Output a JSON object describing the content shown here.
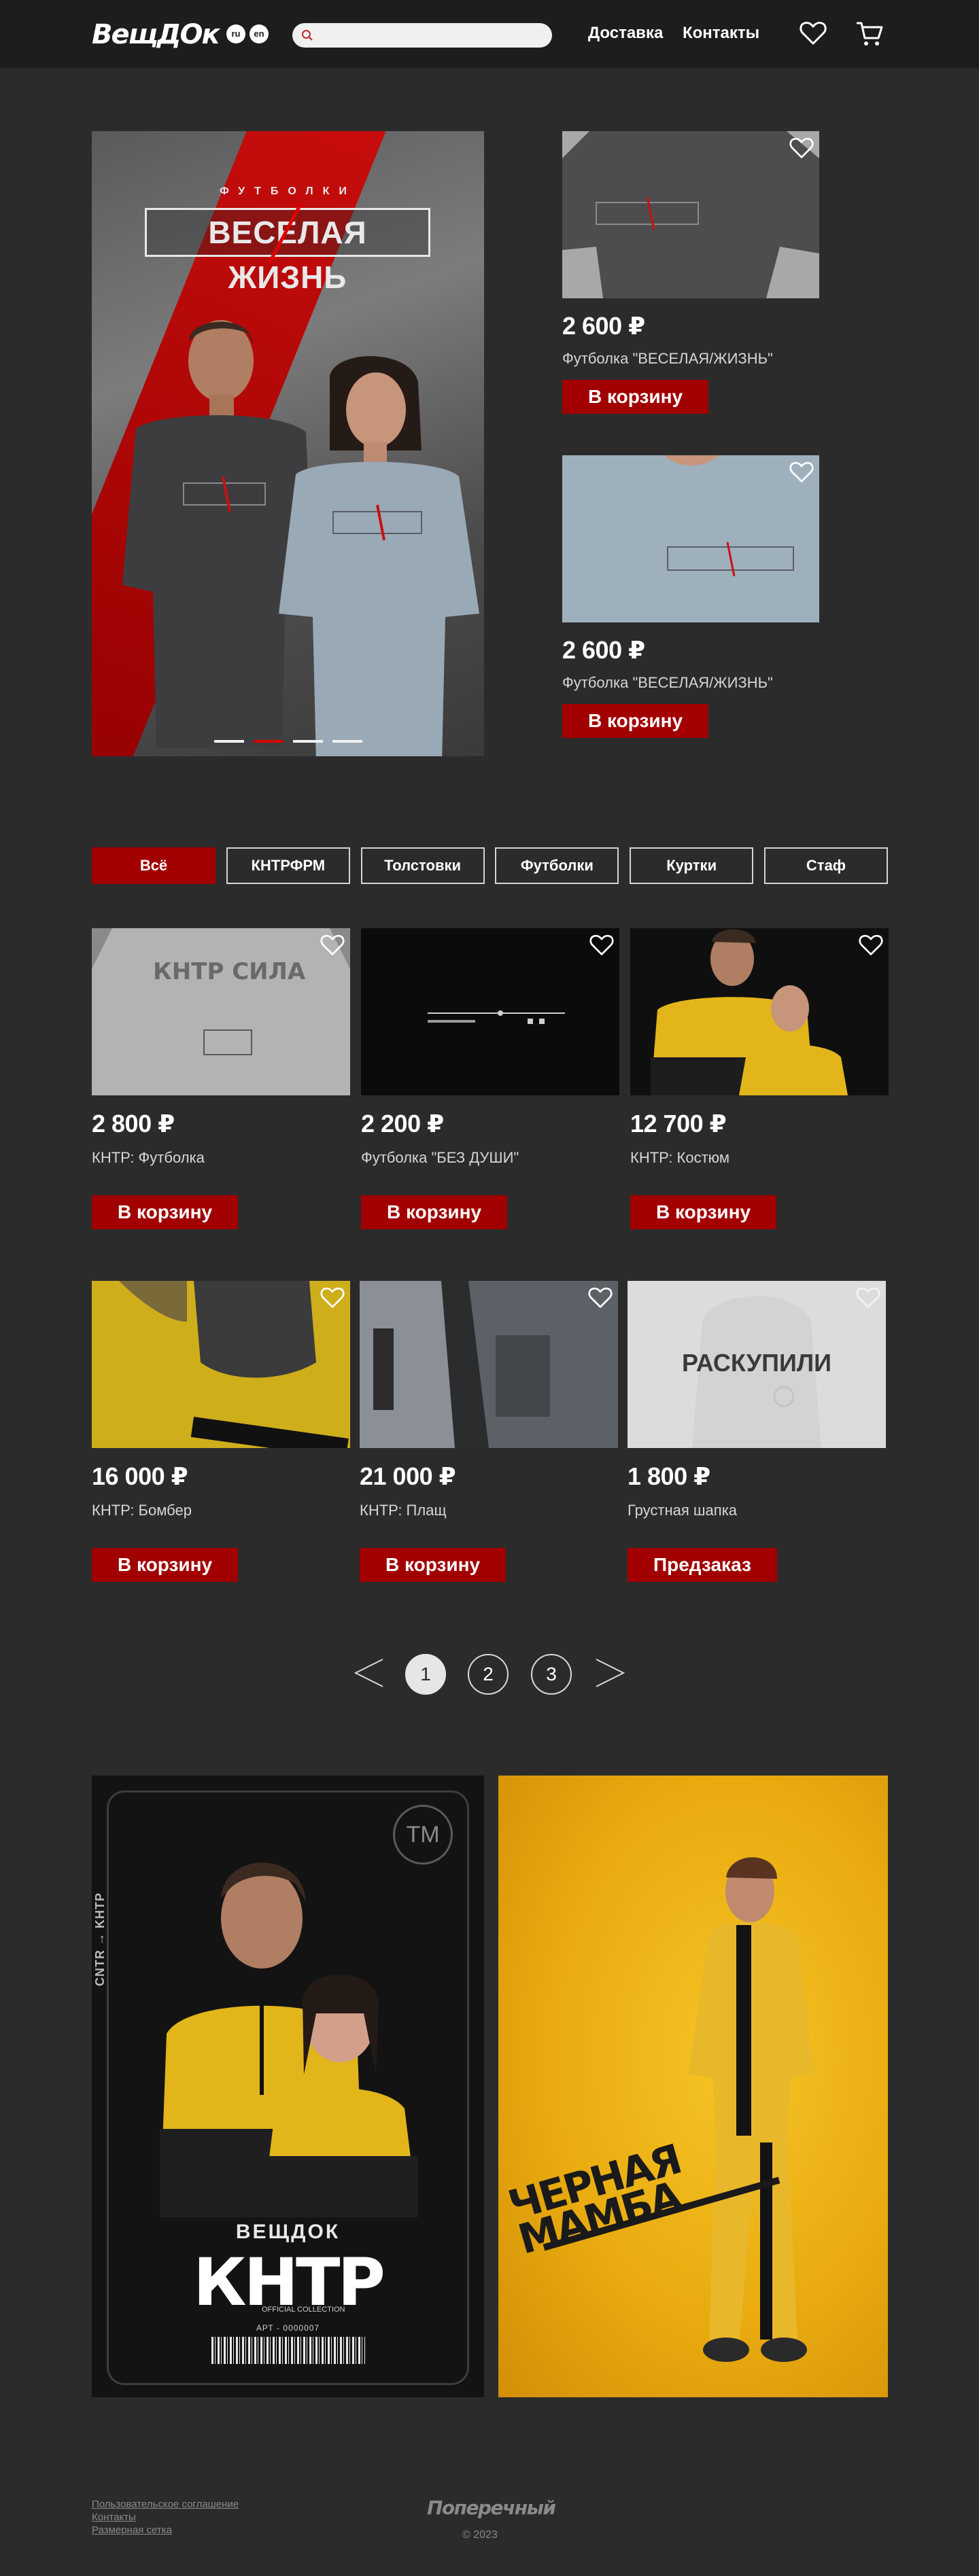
{
  "header": {
    "logo": "ВещДОк",
    "lang_ru": "ru",
    "lang_en": "en",
    "search_placeholder": "",
    "nav": [
      "Доставка",
      "Контакты"
    ]
  },
  "hero": {
    "kicker": "ФУТБОЛКИ",
    "title": "ВЕСЕЛАЯ ЖИЗНЬ",
    "slides": 4,
    "active_slide": 1
  },
  "featured": [
    {
      "price": "2 600 ₽",
      "name": "Футболка \"ВЕСЕЛАЯ/ЖИЗНЬ\"",
      "button": "В корзину",
      "print": "ВЕСЕЛАЯ/ЖИЗНЬ",
      "bg": "#a8a8a8",
      "shirt": "#4a4a4a"
    },
    {
      "price": "2 600 ₽",
      "name": "Футболка \"ВЕСЕЛАЯ/ЖИЗНЬ\"",
      "button": "В корзину",
      "print": "ВЕСЕЛАЯ/ЖИЗНЬ",
      "bg": "#8fa0ad",
      "shirt": "#9aabb8"
    }
  ],
  "filters": [
    {
      "label": "Всё",
      "active": true
    },
    {
      "label": "КНТРФРМ",
      "active": false
    },
    {
      "label": "Толстовки",
      "active": false
    },
    {
      "label": "Футболки",
      "active": false
    },
    {
      "label": "Куртки",
      "active": false
    },
    {
      "label": "Стаф",
      "active": false
    }
  ],
  "products": [
    {
      "price": "2 800 ₽",
      "name": "КНТР: Футболка",
      "button": "В корзину",
      "overlay": "КНТР СИЛА",
      "color": "#8e8e8e"
    },
    {
      "price": "2 200 ₽",
      "name": "Футболка \"БЕЗ ДУШИ\"",
      "button": "В корзину",
      "overlay": "",
      "color": "#0c0c0c"
    },
    {
      "price": "12 700 ₽",
      "name": "КНТР: Костюм",
      "button": "В корзину",
      "overlay": "",
      "color": "#111111"
    },
    {
      "price": "16 000 ₽",
      "name": "КНТР: Бомбер",
      "button": "В корзину",
      "overlay": "",
      "color": "#c7a61a"
    },
    {
      "price": "21 000 ₽",
      "name": "КНТР: Плащ",
      "button": "В корзину",
      "overlay": "",
      "color": "#6e7378"
    },
    {
      "price": "1 800 ₽",
      "name": "Грустная шапка",
      "button": "Предзаказ",
      "overlay": "РАСКУПИЛИ",
      "color": "#d8d8d8"
    }
  ],
  "pagination": {
    "pages": [
      "1",
      "2",
      "3"
    ],
    "current": "1"
  },
  "promo": {
    "vertical_text": "CNTR → KHTP",
    "brand": "ВЕЩДОК",
    "logo": "КНТР",
    "tm": "TM",
    "badge": "OFFICIAL COLLECTION",
    "article": "АРТ - 0000007",
    "mamba_line1": "ЧЕРНАЯ",
    "mamba_line2": "МАМБА"
  },
  "footer": {
    "links": [
      "Пользовательское соглашение",
      "Контакты",
      "Размерная сетка"
    ],
    "brand": "Поперечный",
    "copyright": "© 2023"
  }
}
